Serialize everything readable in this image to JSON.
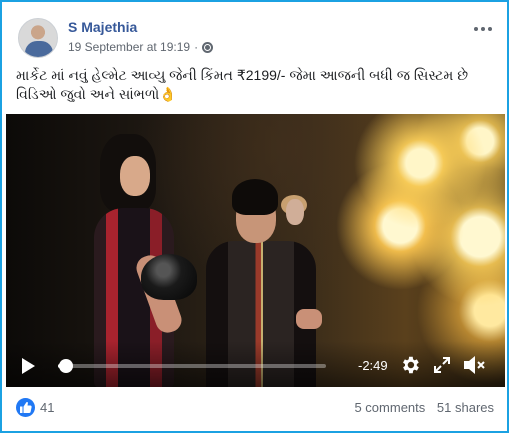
{
  "post": {
    "author": "S Majethia",
    "timestamp": "19 September at 19:19",
    "separator": "·",
    "caption": "માર્કેટ માં નવું હેલ્મેટ આવ્યુ જેની કિંમત ₹2199/- જેમા આજની બધી જ સિસ્ટમ છે વિડિઓ જુવો અને સાંભળો",
    "caption_emoji": "👌"
  },
  "video": {
    "time_remaining": "-2:49",
    "progress": 0.03
  },
  "footer": {
    "likes": "41",
    "comments": "5 comments",
    "shares": "51 shares"
  },
  "colors": {
    "author_link": "#365899",
    "like_blue": "#2078f4",
    "frame_border": "#1ba1e2"
  },
  "icons": [
    "globe-icon",
    "more-icon",
    "play-icon",
    "gear-icon",
    "expand-icon",
    "volume-icon",
    "like-icon"
  ]
}
